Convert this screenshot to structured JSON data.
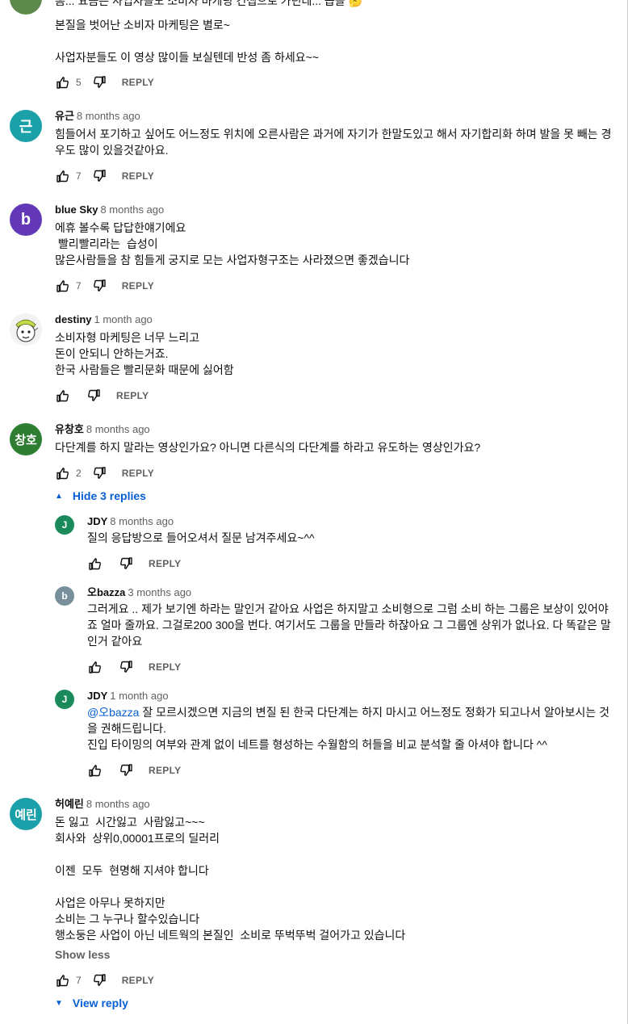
{
  "comments": [
    {
      "text": "본질을 벗어난 소비자 마케팅은 별로~\n\n사업자분들도 이 영상 많이들 보실텐데 반성 좀 하세요~~",
      "partial_line": "흠... 요즘은 사업자들도 소비자 마케팅 컨셉으로 가던데... 씁쓸 🤔",
      "likes": "5",
      "reply_label": "REPLY",
      "avatar_color": "#5b8a4a"
    },
    {
      "author": "유근",
      "time": "8 months ago",
      "avatar_letter": "근",
      "avatar_color": "#1aa0a8",
      "text": "힘들어서 포기하고 싶어도 어느정도 위치에 오른사람은 과거에 자기가 한말도있고 해서 자기합리화 하며 발을 못 빼는 경우도 많이 있을것같아요.",
      "likes": "7",
      "reply_label": "REPLY"
    },
    {
      "author": "blue Sky",
      "time": "8 months ago",
      "avatar_letter": "b",
      "avatar_color": "#6238b7",
      "text": "에휴 볼수록 답답한얘기에요\n 빨리빨리라는  습성이\n많은사람들을 참 힘들게 궁지로 모는 사업자형구조는 사라졌으면 좋겠습니다",
      "likes": "7",
      "reply_label": "REPLY"
    },
    {
      "author": "destiny",
      "time": "1 month ago",
      "avatar_color": "#f2f2f2",
      "text": "소비자형 마케팅은 너무 느리고\n돈이 안되니 안하는거죠.\n한국 사람들은 빨리문화 때문에 싫어함",
      "likes": "",
      "reply_label": "REPLY"
    },
    {
      "author": "유창호",
      "time": "8 months ago",
      "avatar_letter": "창호",
      "avatar_color": "#2e7d32",
      "text": "다단계를 하지 말라는 영상인가요? 아니면 다른식의 다단계를 하라고 유도하는 영상인가요?",
      "likes": "2",
      "reply_label": "REPLY",
      "toggle_label": "Hide 3 replies"
    },
    {
      "author": "허예린",
      "time": "8 months ago",
      "avatar_letter": "예린",
      "avatar_color": "#1aa0a8",
      "text": "돈 잃고  시간잃고  사람잃고~~~\n회사와  상위0,00001프로의 딜러리\n\n이젠  모두  현명해 지셔야 합니다\n\n사업은 아무나 못하지만\n소비는 그 누구나 할수있습니다\n행소둥은 사업이 아닌 네트웍의 본질인  소비로 뚜벅뚜벅 걸어가고 있습니다",
      "show_less": "Show less",
      "likes": "7",
      "reply_label": "REPLY",
      "toggle_label": "View reply"
    }
  ],
  "replies": [
    {
      "author": "JDY",
      "time": "8 months ago",
      "avatar_letter": "J",
      "avatar_color": "#1b8a5a",
      "text": "질의 응답방으로 들어오셔서 질문 남겨주세요~^^",
      "likes": "",
      "reply_label": "REPLY"
    },
    {
      "author": "오bazza",
      "time": "3 months ago",
      "avatar_letter": "b",
      "avatar_color": "#78909c",
      "text": "그러게요 .. 제가 보기엔 하라는 말인거 같아요 사업은 하지말고 소비형으로 그럼 소비 하는 그룹은 보상이 있어야죠 얼마 줄까요. 그걸로200 300을 번다. 여기서도 그룹을 만들라 하잖아요 그 그룹엔 상위가 없나요. 다 똑같은 말인거 같아요",
      "likes": "",
      "reply_label": "REPLY"
    },
    {
      "author": "JDY",
      "time": "1 month ago",
      "avatar_letter": "J",
      "avatar_color": "#1b8a5a",
      "mention": "@오bazza",
      "text": " 잘 모르시겠으면 지금의 변질 된 한국 다단계는 하지 마시고 어느정도 정화가 되고나서 알아보시는 것을 권해드립니다.\n진입 타이밍의 여부와 관계 없이 네트를 형성하는 수월함의 허들을 비교 분석할 줄 아셔야 합니다 ^^",
      "likes": "",
      "reply_label": "REPLY"
    }
  ]
}
